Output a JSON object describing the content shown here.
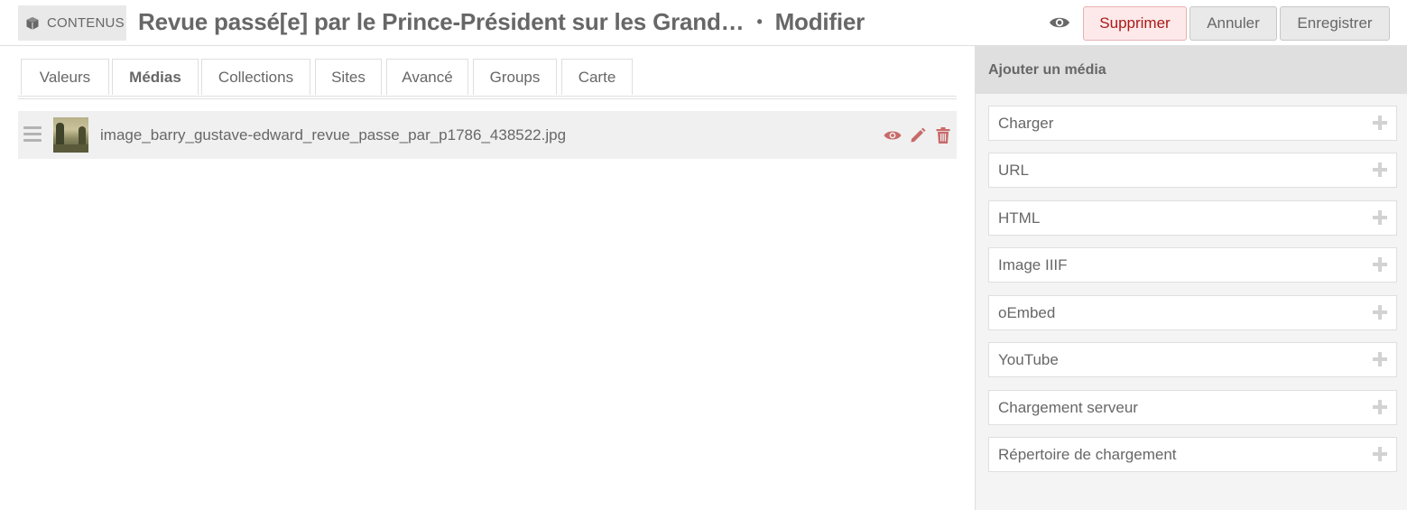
{
  "header": {
    "section": "CONTENUS",
    "title": "Revue passé[e] par le Prince-Président sur les Grand…",
    "separator": "•",
    "mode": "Modifier",
    "buttons": {
      "delete": "Supprimer",
      "cancel": "Annuler",
      "save": "Enregistrer"
    }
  },
  "tabs": [
    {
      "label": "Valeurs",
      "active": false
    },
    {
      "label": "Médias",
      "active": true
    },
    {
      "label": "Collections",
      "active": false
    },
    {
      "label": "Sites",
      "active": false
    },
    {
      "label": "Avancé",
      "active": false
    },
    {
      "label": "Groups",
      "active": false
    },
    {
      "label": "Carte",
      "active": false
    }
  ],
  "media": [
    {
      "filename": "image_barry_gustave-edward_revue_passe_par_p1786_438522.jpg"
    }
  ],
  "sidebar": {
    "heading": "Ajouter un média",
    "options": [
      "Charger",
      "URL",
      "HTML",
      "Image IIIF",
      "oEmbed",
      "YouTube",
      "Chargement serveur",
      "Répertoire de chargement"
    ]
  },
  "colors": {
    "text": "#676767",
    "danger": "#a91919",
    "action_icon": "#c96a6a",
    "sidebar_bg": "#f4f4f4"
  }
}
